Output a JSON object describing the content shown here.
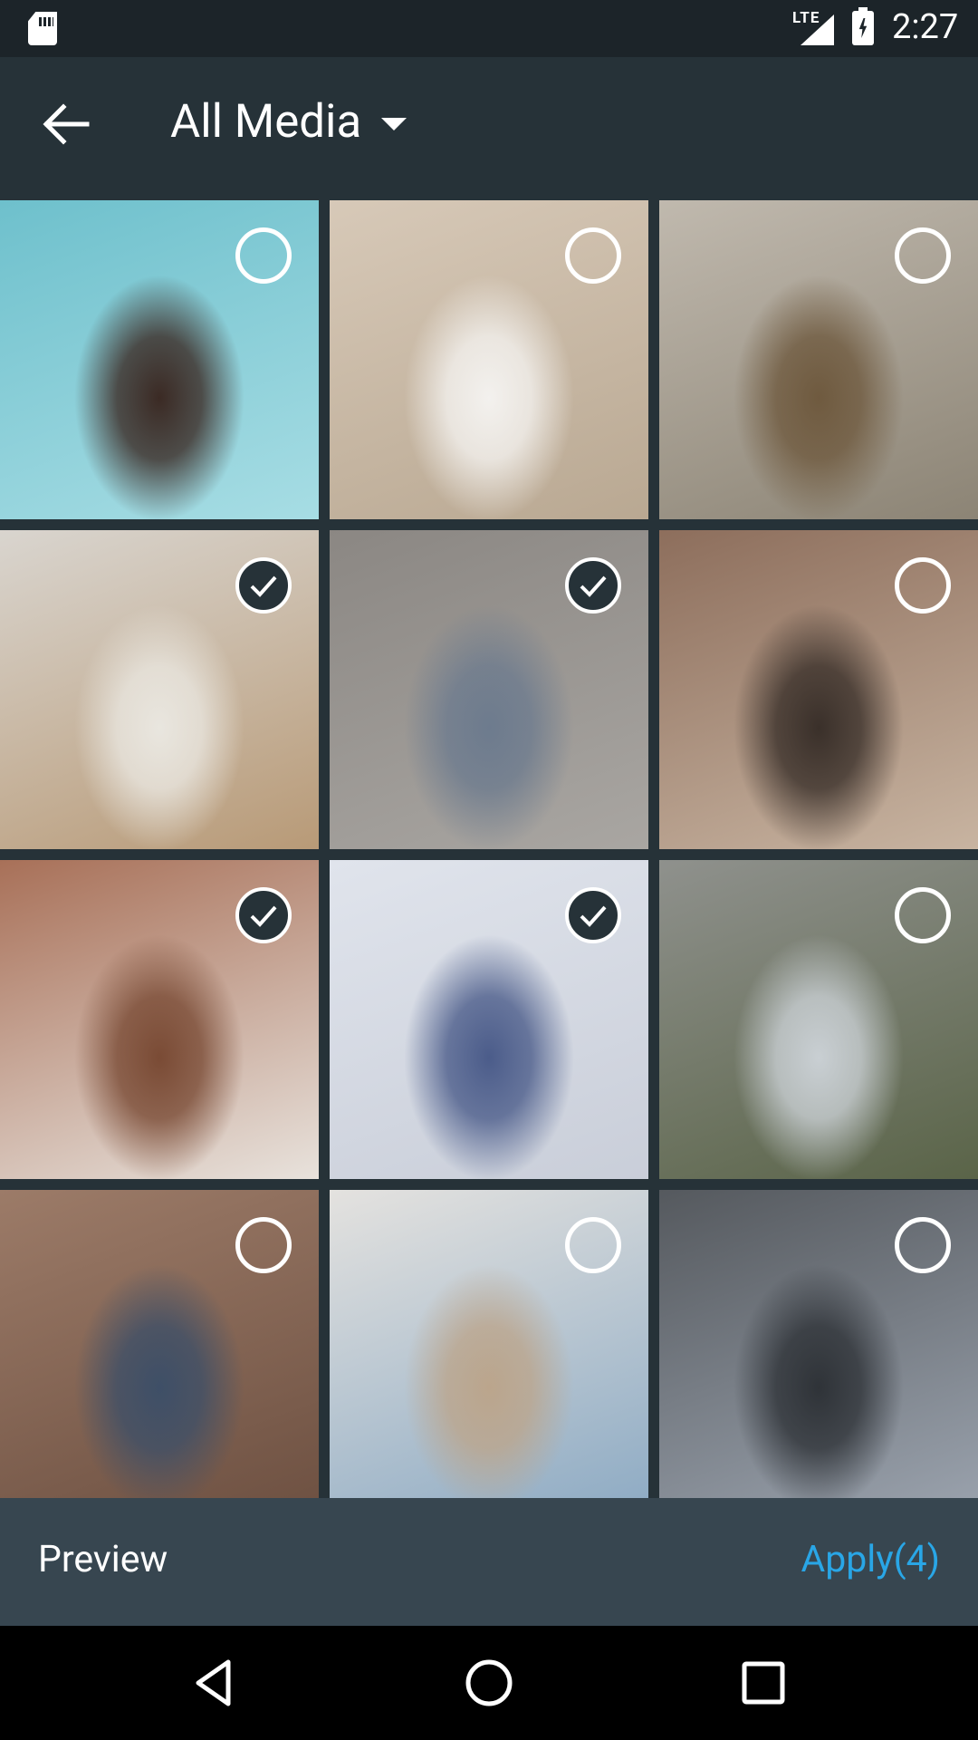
{
  "status_bar": {
    "network": "LTE",
    "time": "2:27",
    "icons": [
      "sd-card-icon",
      "signal-icon",
      "battery-charging-icon"
    ]
  },
  "toolbar": {
    "back_icon": "arrow-back-icon",
    "title": "All Media",
    "dropdown_icon": "caret-down-icon"
  },
  "grid": {
    "photos": [
      {
        "selected": false,
        "colors": [
          "#6ec0cc",
          "#a7dde4",
          "#3b2a24"
        ]
      },
      {
        "selected": false,
        "colors": [
          "#d7c9b8",
          "#b9a892",
          "#f3f1ee"
        ]
      },
      {
        "selected": false,
        "colors": [
          "#c0b9ae",
          "#8c8475",
          "#6f5a3f"
        ]
      },
      {
        "selected": true,
        "colors": [
          "#d9d5cf",
          "#b89a77",
          "#e9e6df"
        ]
      },
      {
        "selected": true,
        "colors": [
          "#8b8783",
          "#a9a6a2",
          "#6d7b8e"
        ]
      },
      {
        "selected": false,
        "colors": [
          "#8d6e5c",
          "#c8b4a1",
          "#3a302a"
        ]
      },
      {
        "selected": true,
        "colors": [
          "#a87058",
          "#e8e2dc",
          "#7a4b35"
        ]
      },
      {
        "selected": true,
        "colors": [
          "#e0e4ec",
          "#c9ced9",
          "#4b5c8a"
        ]
      },
      {
        "selected": false,
        "colors": [
          "#8f918d",
          "#5a6448",
          "#c9cfd3"
        ]
      },
      {
        "selected": false,
        "colors": [
          "#9c7b68",
          "#6e5142",
          "#3e4f67"
        ]
      },
      {
        "selected": false,
        "colors": [
          "#e4e2df",
          "#8eabc4",
          "#bba58c"
        ]
      },
      {
        "selected": false,
        "colors": [
          "#55595e",
          "#9aa2ad",
          "#2f3338"
        ]
      }
    ]
  },
  "actions": {
    "preview_label": "Preview",
    "apply_label": "Apply(4)"
  },
  "nav_bar": {
    "icons": [
      "nav-back-icon",
      "nav-home-icon",
      "nav-recents-icon"
    ]
  },
  "colors": {
    "toolbar": "#263238",
    "action_bar": "#374650",
    "accent": "#29a6e6"
  }
}
